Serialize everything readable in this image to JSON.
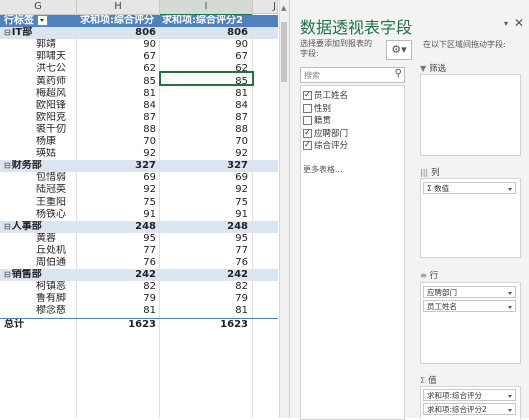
{
  "columns": {
    "g": "G",
    "h": "H",
    "i": "I",
    "j": "J"
  },
  "pivot": {
    "header": {
      "row_label": "行标签",
      "col_h": "求和项:综合评分",
      "col_i": "求和项:综合评分2"
    },
    "rows": [
      {
        "type": "group",
        "label": "IT部",
        "h": "806",
        "i": "806"
      },
      {
        "type": "item",
        "label": "郭靖",
        "h": "90",
        "i": "90"
      },
      {
        "type": "item",
        "label": "郭啸天",
        "h": "67",
        "i": "67"
      },
      {
        "type": "item",
        "label": "洪七公",
        "h": "62",
        "i": "62"
      },
      {
        "type": "item",
        "label": "黄药师",
        "h": "85",
        "i": "85"
      },
      {
        "type": "item",
        "label": "梅超风",
        "h": "81",
        "i": "81"
      },
      {
        "type": "item",
        "label": "欧阳锋",
        "h": "84",
        "i": "84"
      },
      {
        "type": "item",
        "label": "欧阳克",
        "h": "87",
        "i": "87"
      },
      {
        "type": "item",
        "label": "裘千仞",
        "h": "88",
        "i": "88"
      },
      {
        "type": "item",
        "label": "杨康",
        "h": "70",
        "i": "70"
      },
      {
        "type": "item",
        "label": "瑛姑",
        "h": "92",
        "i": "92"
      },
      {
        "type": "group",
        "label": "财务部",
        "h": "327",
        "i": "327"
      },
      {
        "type": "item",
        "label": "包惜弱",
        "h": "69",
        "i": "69"
      },
      {
        "type": "item",
        "label": "陆冠英",
        "h": "92",
        "i": "92"
      },
      {
        "type": "item",
        "label": "王重阳",
        "h": "75",
        "i": "75"
      },
      {
        "type": "item",
        "label": "杨铁心",
        "h": "91",
        "i": "91"
      },
      {
        "type": "group",
        "label": "人事部",
        "h": "248",
        "i": "248"
      },
      {
        "type": "item",
        "label": "黄蓉",
        "h": "95",
        "i": "95"
      },
      {
        "type": "item",
        "label": "丘处机",
        "h": "77",
        "i": "77"
      },
      {
        "type": "item",
        "label": "周伯通",
        "h": "76",
        "i": "76"
      },
      {
        "type": "group",
        "label": "销售部",
        "h": "242",
        "i": "242"
      },
      {
        "type": "item",
        "label": "柯镇恶",
        "h": "82",
        "i": "82"
      },
      {
        "type": "item",
        "label": "鲁有脚",
        "h": "79",
        "i": "79"
      },
      {
        "type": "item",
        "label": "穆念慈",
        "h": "81",
        "i": "81"
      },
      {
        "type": "total",
        "label": "总计",
        "h": "1623",
        "i": "1623"
      }
    ]
  },
  "pane": {
    "title": "数据透视表字段",
    "choose_line1": "选择要添加到报表的",
    "choose_line2": "字段:",
    "drag_hint": "在以下区域间拖动字段:",
    "search_placeholder": "搜索",
    "fields": [
      {
        "label": "员工姓名",
        "checked": true
      },
      {
        "label": "性别",
        "checked": false
      },
      {
        "label": "籍贯",
        "checked": false
      },
      {
        "label": "应聘部门",
        "checked": true
      },
      {
        "label": "综合评分",
        "checked": true
      }
    ],
    "more_tables": "更多表格...",
    "zones": {
      "filter": {
        "title": "筛选"
      },
      "columns": {
        "title": "列",
        "items": [
          "Σ 数值"
        ]
      },
      "rows": {
        "title": "行",
        "items": [
          "应聘部门",
          "员工姓名"
        ]
      },
      "values": {
        "title": "值",
        "items": [
          "求和项:综合评分",
          "求和项:综合评分2"
        ]
      }
    }
  }
}
